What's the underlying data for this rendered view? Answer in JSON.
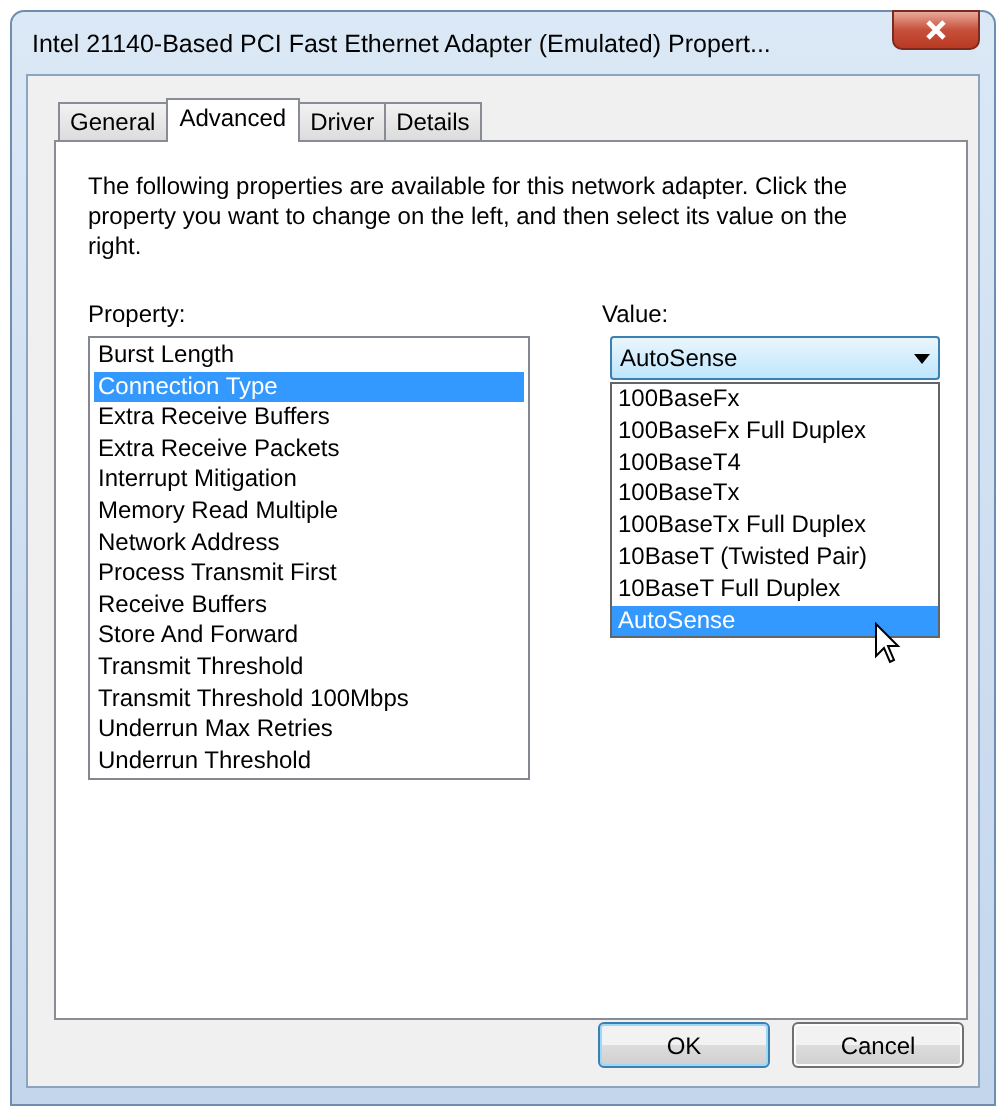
{
  "window": {
    "title": "Intel 21140-Based PCI Fast Ethernet Adapter (Emulated) Propert..."
  },
  "tabs": [
    {
      "label": "General",
      "selected": false
    },
    {
      "label": "Advanced",
      "selected": true
    },
    {
      "label": "Driver",
      "selected": false
    },
    {
      "label": "Details",
      "selected": false
    }
  ],
  "intro": "The following properties are available for this network adapter. Click the property you want to change on the left, and then select its value on the right.",
  "property_label": "Property:",
  "properties": [
    {
      "label": "Burst Length",
      "selected": false
    },
    {
      "label": "Connection Type",
      "selected": true
    },
    {
      "label": "Extra Receive Buffers",
      "selected": false
    },
    {
      "label": "Extra Receive Packets",
      "selected": false
    },
    {
      "label": "Interrupt Mitigation",
      "selected": false
    },
    {
      "label": "Memory Read Multiple",
      "selected": false
    },
    {
      "label": "Network Address",
      "selected": false
    },
    {
      "label": "Process Transmit First",
      "selected": false
    },
    {
      "label": "Receive Buffers",
      "selected": false
    },
    {
      "label": "Store And Forward",
      "selected": false
    },
    {
      "label": "Transmit Threshold",
      "selected": false
    },
    {
      "label": "Transmit Threshold 100Mbps",
      "selected": false
    },
    {
      "label": "Underrun Max Retries",
      "selected": false
    },
    {
      "label": "Underrun Threshold",
      "selected": false
    }
  ],
  "value_label": "Value:",
  "value": {
    "current": "AutoSense",
    "expanded": true,
    "options": [
      {
        "label": "100BaseFx",
        "selected": false
      },
      {
        "label": "100BaseFx Full Duplex",
        "selected": false
      },
      {
        "label": "100BaseT4",
        "selected": false
      },
      {
        "label": "100BaseTx",
        "selected": false
      },
      {
        "label": "100BaseTx Full Duplex",
        "selected": false
      },
      {
        "label": "10BaseT (Twisted Pair)",
        "selected": false
      },
      {
        "label": "10BaseT Full Duplex",
        "selected": false
      },
      {
        "label": "AutoSense",
        "selected": true
      }
    ]
  },
  "buttons": [
    {
      "label": "OK",
      "default": true
    },
    {
      "label": "Cancel",
      "default": false
    }
  ]
}
